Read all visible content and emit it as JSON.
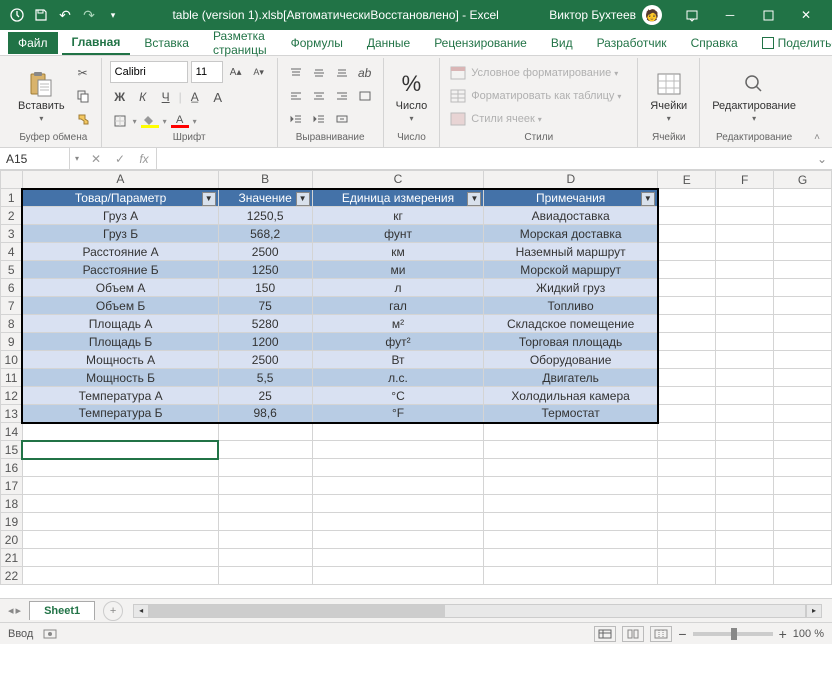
{
  "title": "table (version 1).xlsb[АвтоматическиВосстановлено] - Excel",
  "user": "Виктор Бухтеев",
  "tabs": {
    "file": "Файл",
    "home": "Главная",
    "insert": "Вставка",
    "layout": "Разметка страницы",
    "formulas": "Формулы",
    "data": "Данные",
    "review": "Рецензирование",
    "view": "Вид",
    "developer": "Разработчик",
    "help": "Справка",
    "share": "Поделиться"
  },
  "ribbon": {
    "clipboard": {
      "paste": "Вставить",
      "label": "Буфер обмена"
    },
    "font": {
      "name": "Calibri",
      "size": "11",
      "label": "Шрифт",
      "bold": "Ж",
      "italic": "К",
      "underline": "Ч"
    },
    "alignment": {
      "label": "Выравнивание"
    },
    "number": {
      "btn": "Число",
      "label": "Число"
    },
    "styles": {
      "conditional": "Условное форматирование",
      "table": "Форматировать как таблицу",
      "cell": "Стили ячеек",
      "label": "Стили"
    },
    "cells": {
      "btn": "Ячейки",
      "label": "Ячейки"
    },
    "editing": {
      "btn": "Редактирование",
      "label": "Редактирование"
    }
  },
  "namebox": "A15",
  "fx": "fx",
  "columns": [
    "A",
    "B",
    "C",
    "D",
    "E",
    "F",
    "G"
  ],
  "table": {
    "headers": [
      "Товар/Параметр",
      "Значение",
      "Единица измерения",
      "Примечания"
    ],
    "rows": [
      [
        "Груз А",
        "1250,5",
        "кг",
        "Авиадоставка"
      ],
      [
        "Груз Б",
        "568,2",
        "фунт",
        "Морская доставка"
      ],
      [
        "Расстояние А",
        "2500",
        "км",
        "Наземный маршрут"
      ],
      [
        "Расстояние Б",
        "1250",
        "ми",
        "Морской маршрут"
      ],
      [
        "Объем А",
        "150",
        "л",
        "Жидкий груз"
      ],
      [
        "Объем Б",
        "75",
        "гал",
        "Топливо"
      ],
      [
        "Площадь А",
        "5280",
        "м²",
        "Складское помещение"
      ],
      [
        "Площадь Б",
        "1200",
        "фут²",
        "Торговая площадь"
      ],
      [
        "Мощность А",
        "2500",
        "Вт",
        "Оборудование"
      ],
      [
        "Мощность Б",
        "5,5",
        "л.с.",
        "Двигатель"
      ],
      [
        "Температура А",
        "25",
        "°C",
        "Холодильная камера"
      ],
      [
        "Температура Б",
        "98,6",
        "°F",
        "Термостат"
      ]
    ]
  },
  "sheet": "Sheet1",
  "status": "Ввод",
  "zoom": "100 %",
  "row_count": 22
}
